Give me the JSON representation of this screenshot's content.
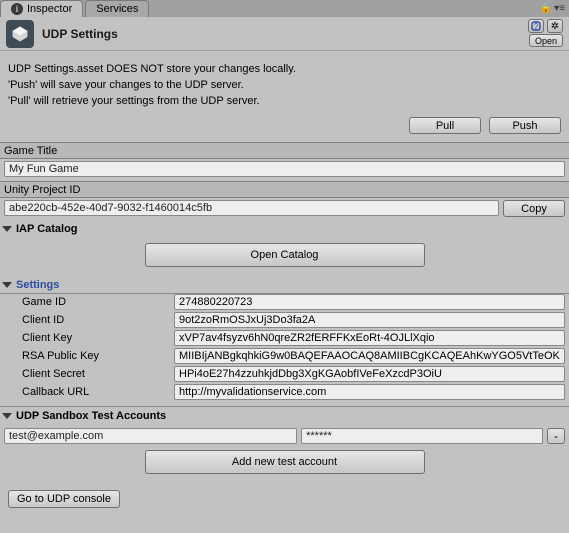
{
  "tabs": {
    "inspector": "Inspector",
    "services": "Services"
  },
  "header": {
    "title": "UDP Settings",
    "open": "Open"
  },
  "info": {
    "l1": "UDP Settings.asset DOES NOT store your changes locally.",
    "l2": "'Push' will save your changes to the UDP server.",
    "l3": "'Pull' will retrieve your settings from the UDP server."
  },
  "buttons": {
    "pull": "Pull",
    "push": "Push",
    "copy": "Copy",
    "open_catalog": "Open Catalog",
    "add_account": "Add new test account",
    "goto_console": "Go to UDP console"
  },
  "labels": {
    "game_title": "Game Title",
    "unity_project_id": "Unity Project ID",
    "iap_catalog": "IAP Catalog",
    "settings": "Settings",
    "game_id": "Game ID",
    "client_id": "Client ID",
    "client_key": "Client Key",
    "rsa_public_key": "RSA Public Key",
    "client_secret": "Client Secret",
    "callback_url": "Callback URL",
    "sandbox": "UDP Sandbox Test Accounts"
  },
  "values": {
    "game_title": "My Fun Game",
    "unity_project_id": "abe220cb-452e-40d7-9032-f1460014c5fb",
    "game_id": "274880220723",
    "client_id": "9ot2zoRmOSJxUj3Do3fa2A",
    "client_key": "xVP7av4fsyzv6hN0qreZR2fERFFKxEoRt-4OJLlXqio",
    "rsa_public_key": "MIIBIjANBgkqhkiG9w0BAQEFAAOCAQ8AMIIBCgKCAQEAhKwYGO5VtTeOK",
    "client_secret": "HPi4oE27h4zzuhkjdDbg3XgKGAobfIVeFeXzcdP3OiU",
    "callback_url": "http://myvalidationservice.com"
  },
  "sandbox": {
    "email": "test@example.com",
    "password": "******"
  }
}
